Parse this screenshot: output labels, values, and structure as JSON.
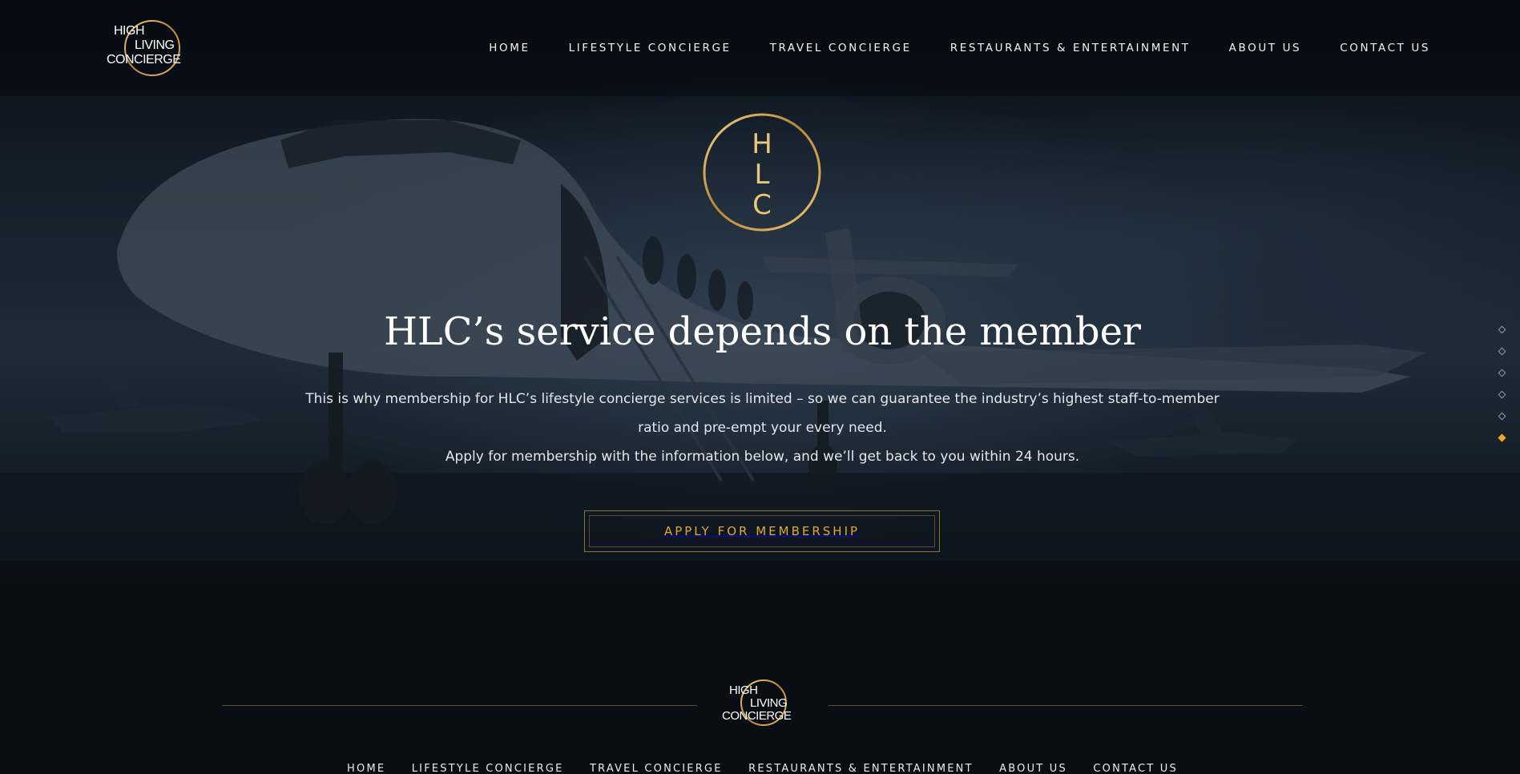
{
  "brand": {
    "logo_lines": [
      "HIGH",
      "LIVING",
      "CONCIERGE"
    ],
    "emblem_letters": [
      "H",
      "L",
      "C"
    ],
    "gold": "#e1a92b",
    "accent": "#f5a623"
  },
  "nav": {
    "items": [
      {
        "label": "HOME"
      },
      {
        "label": "LIFESTYLE CONCIERGE"
      },
      {
        "label": "TRAVEL CONCIERGE"
      },
      {
        "label": "RESTAURANTS & ENTERTAINMENT"
      },
      {
        "label": "ABOUT US"
      },
      {
        "label": "CONTACT US"
      }
    ]
  },
  "hero": {
    "headline": "HLC’s service depends on the member",
    "paragraph_1": "This is why membership for HLC’s lifestyle concierge services is limited – so we can guarantee the industry’s highest staff-to-member ratio and pre-empt your every need.",
    "paragraph_2": "Apply for membership with the information below, and we’ll get back to you within 24 hours.",
    "cta_label": "APPLY FOR MEMBERSHIP"
  },
  "pager": {
    "count": 6,
    "active_index": 5
  },
  "footer": {
    "nav_items": [
      {
        "label": "HOME"
      },
      {
        "label": "LIFESTYLE CONCIERGE"
      },
      {
        "label": "TRAVEL CONCIERGE"
      },
      {
        "label": "RESTAURANTS & ENTERTAINMENT"
      },
      {
        "label": "ABOUT US"
      },
      {
        "label": "CONTACT US"
      }
    ]
  }
}
